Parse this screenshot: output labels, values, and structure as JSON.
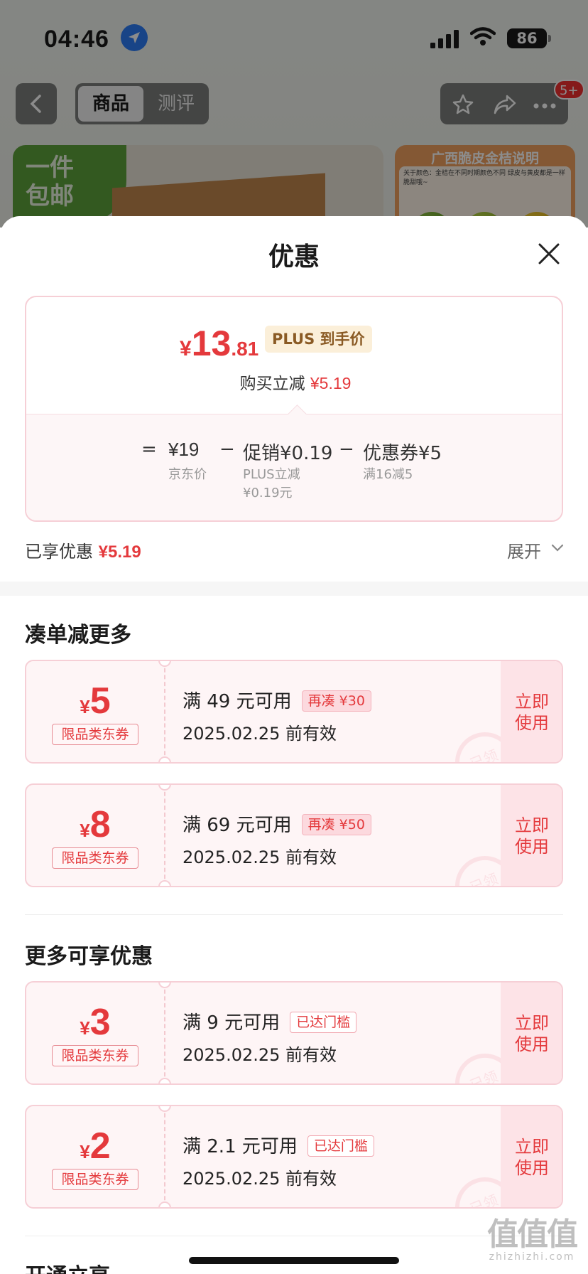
{
  "status": {
    "time": "04:46",
    "battery": "86"
  },
  "nav": {
    "tab_goods": "商品",
    "tab_review": "测评",
    "badge": "5+"
  },
  "banner": {
    "tag_line1": "一件",
    "tag_line2": "包邮",
    "side_title": "广西脆皮金桔说明",
    "side_note": "关于颜色：金桔在不同时期颜色不同 绿皮与黄皮都是一样脆甜哦~"
  },
  "sheet": {
    "title": "优惠",
    "price_card": {
      "currency": "¥",
      "price_int": "13",
      "price_dec": ".81",
      "plus_label": "PLUS 到手价",
      "buy_reduce_label": "购买立减",
      "buy_reduce_value": "¥5.19",
      "eq_sign": "=",
      "jd_price": "¥19",
      "jd_price_label": "京东价",
      "minus1": "−",
      "promo": "促销¥0.19",
      "promo_sub1": "PLUS立减",
      "promo_sub2": "¥0.19元",
      "minus2": "−",
      "coupon": "优惠券¥5",
      "coupon_sub": "满16减5"
    },
    "enjoyed_label": "已享优惠",
    "enjoyed_value": "¥5.19",
    "expand_label": "展开",
    "section1_title": "凑单减更多",
    "section2_title": "更多可享优惠",
    "section3_title": "开通立享",
    "coupons": [
      {
        "currency": "¥",
        "amount": "5",
        "type": "限品类东券",
        "condition": "满 49 元可用",
        "tag": "再凑 ¥30",
        "date": "2025.02.25 前有效",
        "stamp": "已领",
        "action_line1": "立即",
        "action_line2": "使用"
      },
      {
        "currency": "¥",
        "amount": "8",
        "type": "限品类东券",
        "condition": "满 69 元可用",
        "tag": "再凑 ¥50",
        "date": "2025.02.25 前有效",
        "stamp": "已领",
        "action_line1": "立即",
        "action_line2": "使用"
      },
      {
        "currency": "¥",
        "amount": "3",
        "type": "限品类东券",
        "condition": "满 9 元可用",
        "tag": "已达门槛",
        "date": "2025.02.25 前有效",
        "stamp": "已领",
        "action_line1": "立即",
        "action_line2": "使用"
      },
      {
        "currency": "¥",
        "amount": "2",
        "type": "限品类东券",
        "condition": "满 2.1 元可用",
        "tag": "已达门槛",
        "date": "2025.02.25 前有效",
        "stamp": "已领",
        "action_line1": "立即",
        "action_line2": "使用"
      }
    ]
  },
  "watermark": {
    "main": "值值值",
    "sub": "zhizhizhi.com"
  },
  "colors": {
    "accent_red": "#e4393c",
    "coupon_border": "#f6cfd6",
    "action_bg": "#fde3e7"
  }
}
